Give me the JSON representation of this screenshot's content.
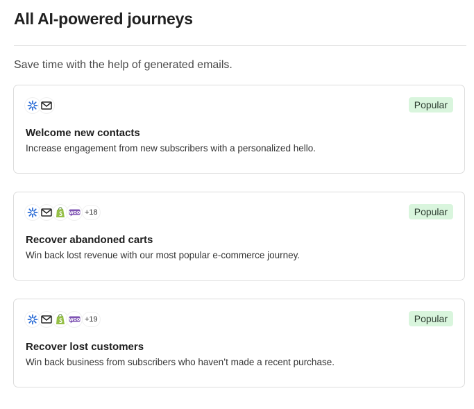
{
  "title": "All AI-powered journeys",
  "subtitle": "Save time with the help of generated emails.",
  "colors": {
    "badge_bg": "#d9f5dd",
    "ai_icon": "#2f6fd6",
    "shopify": "#95bf47",
    "woo": "#7f54b3"
  },
  "cards": [
    {
      "title": "Welcome new contacts",
      "description": "Increase engagement from new subscribers with a personalized hello.",
      "badge": "Popular",
      "icons": [
        "ai-sparkle-icon",
        "envelope-icon"
      ],
      "more": ""
    },
    {
      "title": "Recover abandoned carts",
      "description": "Win back lost revenue with our most popular e-commerce journey.",
      "badge": "Popular",
      "icons": [
        "ai-sparkle-icon",
        "envelope-icon",
        "shopify-icon",
        "woocommerce-icon"
      ],
      "more": "+18"
    },
    {
      "title": "Recover lost customers",
      "description": "Win back business from subscribers who haven’t made a recent purchase.",
      "badge": "Popular",
      "icons": [
        "ai-sparkle-icon",
        "envelope-icon",
        "shopify-icon",
        "woocommerce-icon"
      ],
      "more": "+19"
    }
  ]
}
